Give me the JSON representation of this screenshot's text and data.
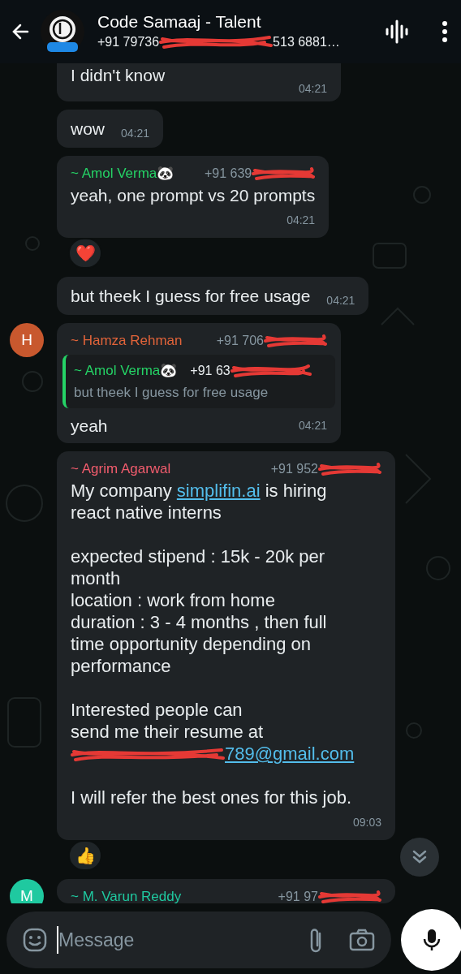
{
  "header": {
    "title": "Code Samaaj - Talent",
    "subtitle_start": "+91 79736",
    "subtitle_end": "513 6881…"
  },
  "messages": [
    {
      "kind": "text",
      "text": "I didn't know",
      "time": "04:21",
      "cut": true
    },
    {
      "kind": "text",
      "text": "wow",
      "time": "04:21"
    },
    {
      "kind": "text",
      "sender": {
        "name": "~ Amol Verma🐼",
        "color": "#25d366",
        "phone": "+91 639"
      },
      "text": "yeah, one prompt vs 20 prompts",
      "time": "04:21",
      "reaction": "❤️"
    },
    {
      "kind": "text",
      "text": "but theek I guess for free usage",
      "time": "04:21"
    },
    {
      "kind": "reply",
      "sender": {
        "name": "~ Hamza Rehman",
        "color": "#e2643a",
        "phone": "+91 706",
        "avatar": {
          "kind": "letter",
          "letter": "H",
          "color": "#c8582e"
        }
      },
      "quote": {
        "name": "~ Amol Verma🐼",
        "color": "#25d366",
        "phone": "+91 63",
        "text": "but theek I guess for free usage"
      },
      "text": "yeah",
      "time": "04:21"
    },
    {
      "kind": "rich",
      "sender": {
        "name": "~ Agrim Agarwal",
        "color": "#f15c6d",
        "phone": "+91 952"
      },
      "segments": [
        {
          "kind": "plain",
          "text": "My company "
        },
        {
          "kind": "link",
          "text": "simplifin.ai"
        },
        {
          "kind": "plain",
          "text": " is hiring react native interns\n\nexpected stipend : 15k - 20k per month\nlocation : work from home\nduration : 3 - 4 months , then full time opportunity depending on performance\n\nInterested people can\nsend me their resume at\n"
        },
        {
          "kind": "redaction"
        },
        {
          "kind": "link",
          "text": "789@gmail.com"
        },
        {
          "kind": "plain",
          "text": "\n\nI will refer the best ones for this job."
        }
      ],
      "time": "09:03",
      "reaction": "👍"
    },
    {
      "kind": "cut_header",
      "sender": {
        "name": "~ M. Varun Reddy",
        "color": "#1fc9a0",
        "phone": "+91 97",
        "avatar": {
          "kind": "letter",
          "letter": "M",
          "color": "#1fc9a0"
        }
      }
    }
  ],
  "composer": {
    "placeholder": "Message"
  }
}
